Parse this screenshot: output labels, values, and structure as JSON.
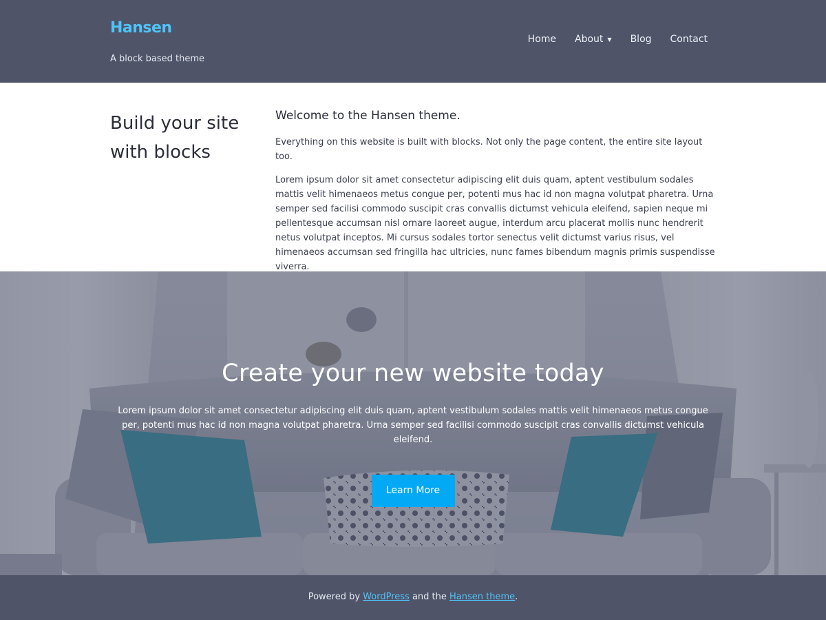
{
  "header": {
    "site_title": "Hansen",
    "tagline": "A block based theme",
    "nav": {
      "home": "Home",
      "about": "About",
      "blog": "Blog",
      "contact": "Contact"
    },
    "background_color": "#4f5469",
    "title_color": "#4fc3f7"
  },
  "intro": {
    "heading": "Build your site with blocks",
    "subheading": "Welcome to the Hansen theme.",
    "paragraph_1": "Everything on this website is built with blocks. Not only the page content, the entire site layout too.",
    "paragraph_2": "Lorem ipsum dolor sit amet consectetur adipiscing elit duis quam, aptent vestibulum sodales mattis velit himenaeos metus congue per, potenti mus hac id non magna volutpat pharetra. Urna semper sed facilisi commodo suscipit cras convallis dictumst vehicula eleifend, sapien neque mi pellentesque accumsan nisl ornare laoreet augue, interdum arcu placerat mollis nunc hendrerit netus volutpat inceptos. Mi cursus sodales tortor senectus velit dictumst varius risus, vel himenaeos accumsan sed fringilla hac ultricies, nunc fames bibendum magnis primis suspendisse viverra."
  },
  "cover": {
    "heading": "Create your new website today",
    "text": "Lorem ipsum dolor sit amet consectetur adipiscing elit duis quam, aptent vestibulum sodales mattis velit himenaeos metus congue per, potenti mus hac id non magna volutpat pharetra. Urna semper sed facilisi commodo suscipit cras convallis dictumst vehicula eleifend.",
    "button_label": "Learn More",
    "button_color": "#03a9f4",
    "background_image": "living-room-sofa-with-teal-pillows"
  },
  "footer": {
    "prefix": "Powered by ",
    "wordpress_link": "WordPress",
    "middle": " and the ",
    "theme_link": "Hansen theme",
    "suffix": "."
  }
}
